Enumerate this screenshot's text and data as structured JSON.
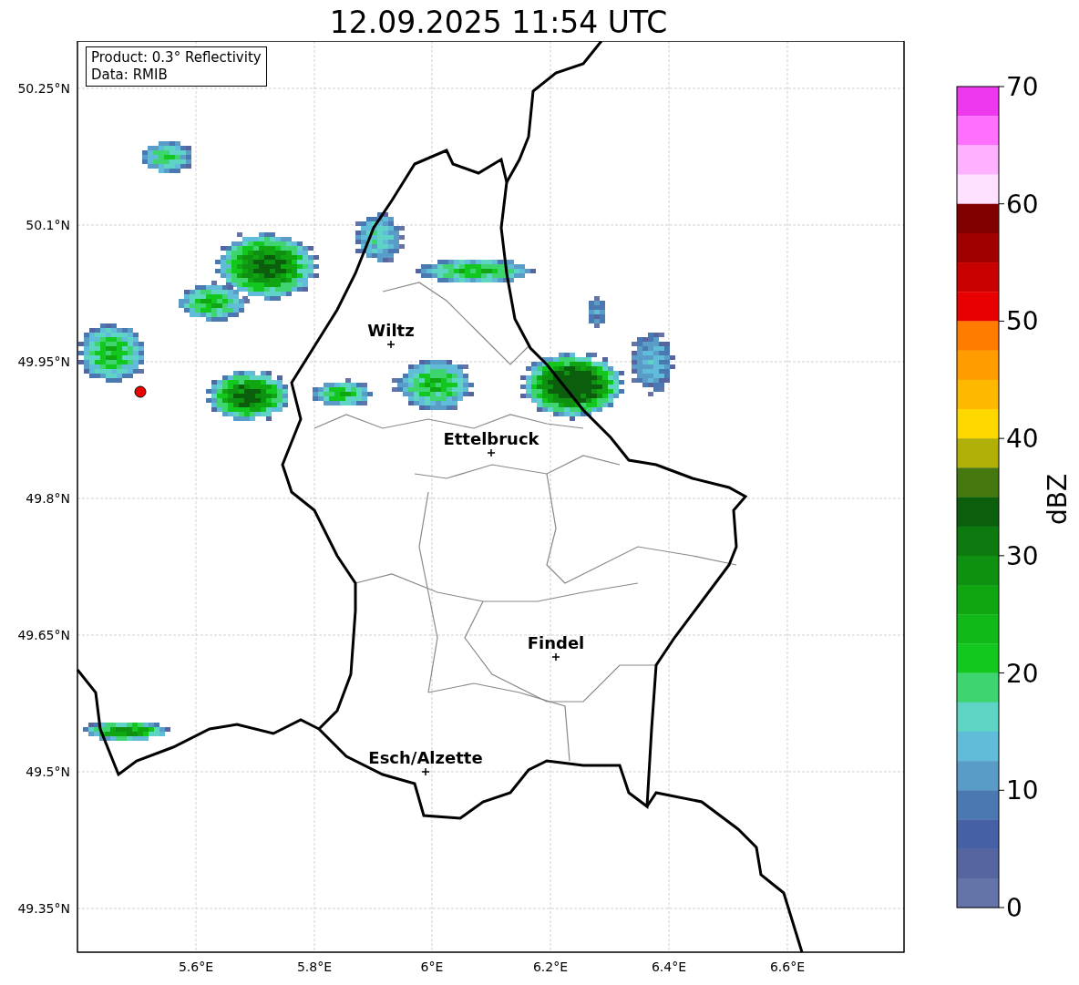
{
  "title": "12.09.2025 11:54 UTC",
  "info_box": [
    "Product: 0.3° Reflectivity",
    "Data: RMIB"
  ],
  "map": {
    "y_ticks": [
      "50.25°N",
      "50.1°N",
      "49.95°N",
      "49.8°N",
      "49.65°N",
      "49.5°N",
      "49.35°N"
    ],
    "x_ticks": [
      "5.6°E",
      "5.8°E",
      "6°E",
      "6.2°E",
      "6.4°E",
      "6.6°E"
    ],
    "places": [
      {
        "name": "Wiltz"
      },
      {
        "name": "Ettelbruck"
      },
      {
        "name": "Findel"
      },
      {
        "name": "Esch/Alzette"
      }
    ]
  },
  "colorbar": {
    "label": "dBZ",
    "ticks": [
      "70",
      "60",
      "50",
      "40",
      "30",
      "20",
      "10",
      "0"
    ],
    "bins": [
      {
        "color": "#ee38ee"
      },
      {
        "color": "#ff70ff"
      },
      {
        "color": "#ffb0ff"
      },
      {
        "color": "#ffe0ff"
      },
      {
        "color": "#800000"
      },
      {
        "color": "#a00000"
      },
      {
        "color": "#c80000"
      },
      {
        "color": "#e80000"
      },
      {
        "color": "#ff7c00"
      },
      {
        "color": "#ff9c00"
      },
      {
        "color": "#ffb800"
      },
      {
        "color": "#ffd800"
      },
      {
        "color": "#b0b008"
      },
      {
        "color": "#467810"
      },
      {
        "color": "#0a5e0c"
      },
      {
        "color": "#0c7a0e"
      },
      {
        "color": "#0e9010"
      },
      {
        "color": "#0fa612"
      },
      {
        "color": "#10b818"
      },
      {
        "color": "#12c81e"
      },
      {
        "color": "#3ed470"
      },
      {
        "color": "#5ed4c4"
      },
      {
        "color": "#60bcd8"
      },
      {
        "color": "#5a9cc8"
      },
      {
        "color": "#4a78b0"
      },
      {
        "color": "#4560a4"
      },
      {
        "color": "#5565a0"
      },
      {
        "color": "#6474a8"
      }
    ]
  }
}
